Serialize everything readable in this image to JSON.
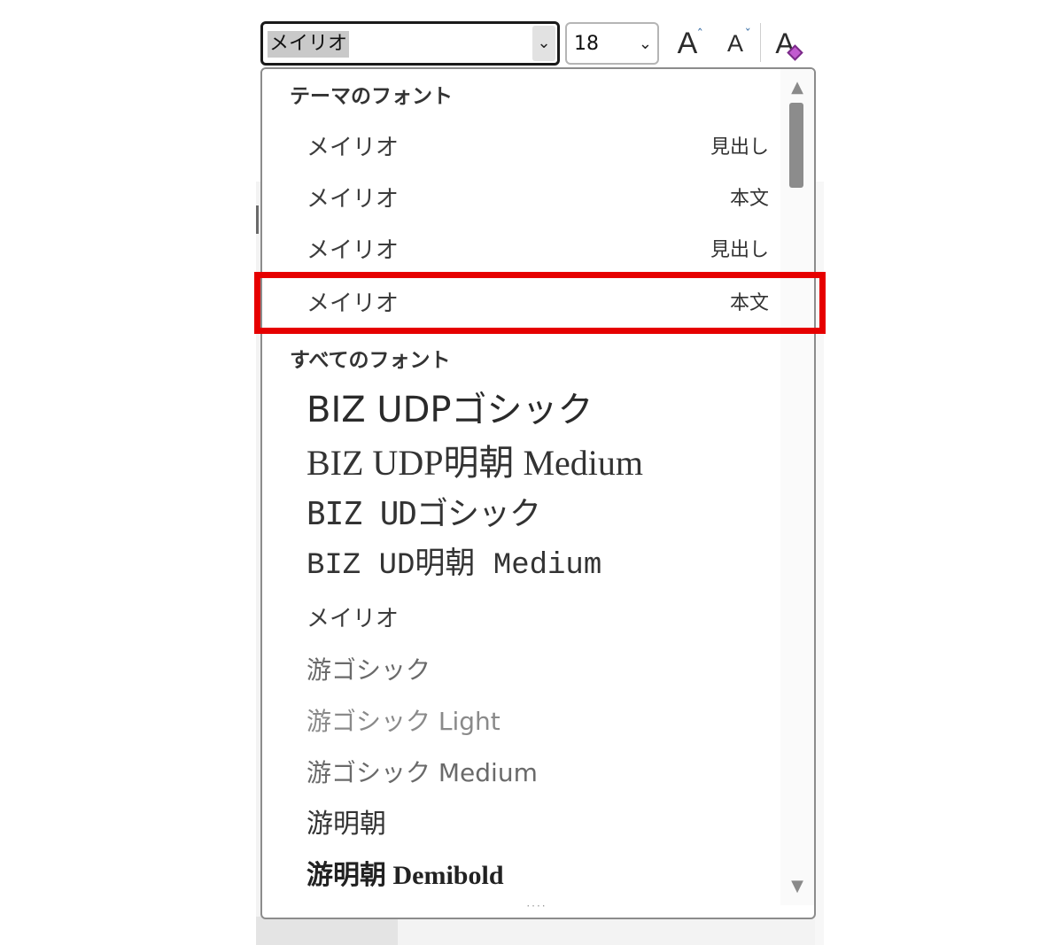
{
  "toolbar": {
    "font_name": "メイリオ",
    "font_size": "18",
    "grow_font_glyph": "A",
    "shrink_font_glyph": "A",
    "clear_format_glyph": "A",
    "caret_up": "ˆ",
    "caret_down": "ˇ",
    "dropdown_arrow": "⌄"
  },
  "dropdown": {
    "theme_header": "テーマのフォント",
    "theme_fonts": [
      {
        "name": "メイリオ",
        "role": "見出し"
      },
      {
        "name": "メイリオ",
        "role": "本文"
      },
      {
        "name": "メイリオ",
        "role": "見出し"
      },
      {
        "name": "メイリオ",
        "role": "本文"
      }
    ],
    "all_header": "すべてのフォント",
    "all_fonts": [
      "BIZ UDPゴシック",
      "BIZ UDP明朝 Medium",
      "BIZ UDゴシック",
      "BIZ UD明朝 Medium",
      "メイリオ",
      "游ゴシック",
      "游ゴシック Light",
      "游ゴシック Medium",
      "游明朝",
      "游明朝 Demibold"
    ],
    "scroll_up": "▲",
    "scroll_down": "▼",
    "grip": "····"
  },
  "colors": {
    "highlight": "#e60000",
    "accent": "#3a6ea5"
  }
}
